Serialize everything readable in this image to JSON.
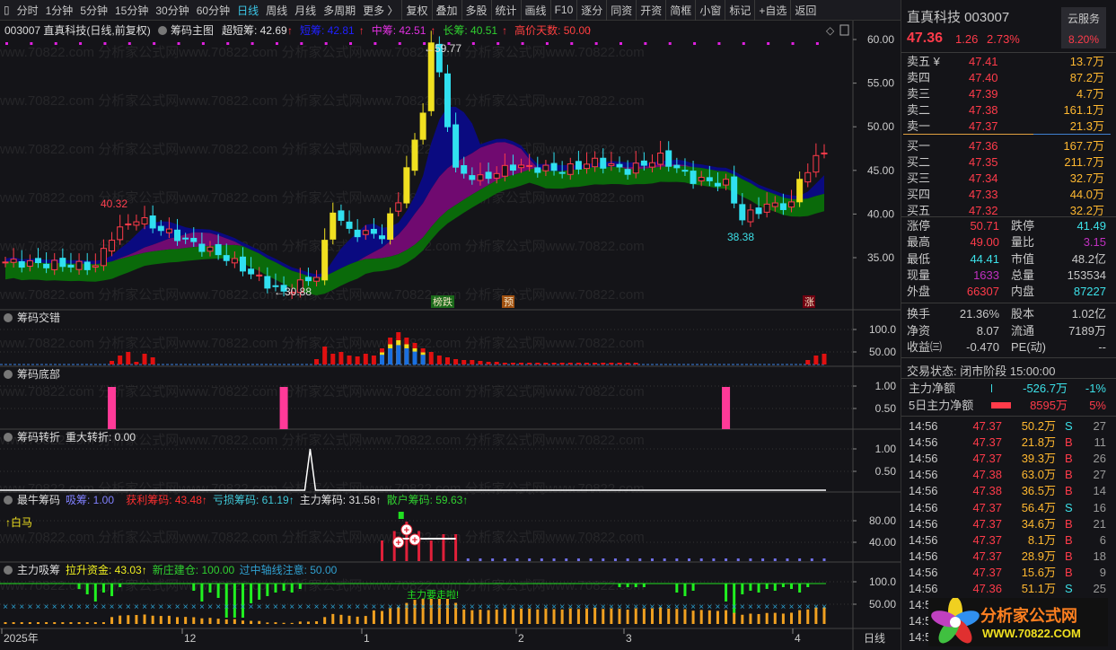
{
  "toolbar": {
    "items": [
      "分时",
      "1分钟",
      "5分钟",
      "15分钟",
      "30分钟",
      "60分钟",
      "日线",
      "周线",
      "月线",
      "多周期",
      "更多 〉",
      "复权",
      "叠加",
      "多股",
      "统计",
      "画线",
      "F10",
      "逐分",
      "同资",
      "开资",
      "简框",
      "小窗",
      "标记",
      "+自选",
      "返回"
    ],
    "active": "日线"
  },
  "main": {
    "title": "003007 直真科技(日线,前复权)",
    "indicator": "筹码主图",
    "labels": [
      {
        "t": "超短筹: 42.69",
        "c": "#e0e0e0"
      },
      {
        "t": "短筹: 42.81",
        "c": "#2020ff"
      },
      {
        "t": "中筹: 42.51",
        "c": "#e030e0"
      },
      {
        "t": "长筹: 40.51",
        "c": "#30d030"
      },
      {
        "t": "高价天数: 50.00",
        "c": "#ff4040"
      }
    ],
    "yticks": [
      "60.00",
      "55.00",
      "50.00",
      "45.00",
      "40.00",
      "35.00"
    ],
    "annotations": {
      "high": "59.77",
      "low": "30.88",
      "mark1": "40.32",
      "mark2": "38.38"
    },
    "tags": [
      "榜跌",
      "预",
      "涨"
    ],
    "price_anchors": [
      [
        0,
        34.5
      ],
      [
        11,
        34
      ],
      [
        13,
        37.5
      ],
      [
        16,
        39.5
      ],
      [
        22,
        37
      ],
      [
        27,
        35
      ],
      [
        32,
        32
      ],
      [
        34,
        31
      ],
      [
        38,
        33
      ],
      [
        39,
        36.5
      ],
      [
        40,
        40.5
      ],
      [
        42,
        38
      ],
      [
        46,
        37.6
      ],
      [
        48,
        41.5
      ],
      [
        49,
        45.5
      ],
      [
        50,
        48
      ],
      [
        51,
        52
      ],
      [
        52,
        59.5
      ],
      [
        53,
        56
      ],
      [
        55,
        45
      ],
      [
        58,
        44
      ],
      [
        62,
        45.5
      ],
      [
        68,
        45
      ],
      [
        72,
        46
      ],
      [
        76,
        45
      ],
      [
        80,
        46.5
      ],
      [
        84,
        44
      ],
      [
        88,
        43.5
      ],
      [
        90,
        39.5
      ],
      [
        93,
        41
      ],
      [
        96,
        41
      ],
      [
        97,
        44
      ],
      [
        100,
        47.3
      ]
    ]
  },
  "panels": [
    {
      "title": "筹码交错",
      "labels": [],
      "yticks": [
        "100.0",
        "50.00"
      ]
    },
    {
      "title": "筹码底部",
      "labels": [],
      "yticks": [
        "1.00",
        "0.50"
      ]
    },
    {
      "title": "筹码转折",
      "labels": [
        {
          "t": "重大转折: 0.00",
          "c": "#e0e0e0"
        }
      ],
      "yticks": [
        "1.00",
        "0.50"
      ]
    },
    {
      "title": "最牛筹码",
      "labels": [
        {
          "t": "吸筹: 1.00",
          "c": "#8080ff"
        },
        {
          "t": "获利筹码: 43.48↑",
          "c": "#ff3030"
        },
        {
          "t": "亏损筹码: 61.19↑",
          "c": "#40c8d8"
        },
        {
          "t": "主力筹码: 31.58↑",
          "c": "#e0e0e0"
        },
        {
          "t": "散户筹码: 59.63↑",
          "c": "#30d030"
        }
      ],
      "yticks": [
        "80.00",
        "40.00"
      ],
      "note": "↑白马"
    },
    {
      "title": "主力吸筹",
      "labels": [
        {
          "t": "拉升资金: 43.03↑",
          "c": "#f0f020"
        },
        {
          "t": "新庄建仓: 100.00",
          "c": "#30d030"
        },
        {
          "t": "过中轴线注意: 50.00",
          "c": "#30a0d0"
        }
      ],
      "yticks": [
        "100.0",
        "50.00"
      ],
      "note": "主力要走啦!"
    }
  ],
  "xaxis": {
    "labels": [
      "2025年",
      "12",
      "1",
      "2",
      "3",
      "4"
    ],
    "period": "日线"
  },
  "quote": {
    "name": "直真科技 003007",
    "price": "47.36",
    "change": "1.26",
    "pct": "2.73%",
    "cloud": "云服务",
    "cloud_pct": "8.20%"
  },
  "book": [
    [
      "卖五 ¥",
      "47.41",
      "13.7万"
    ],
    [
      "卖四",
      "47.40",
      "87.2万"
    ],
    [
      "卖三",
      "47.39",
      "4.7万"
    ],
    [
      "卖二",
      "47.38",
      "161.1万"
    ],
    [
      "卖一",
      "47.37",
      "21.3万"
    ],
    [
      "买一",
      "47.36",
      "167.7万"
    ],
    [
      "买二",
      "47.35",
      "211.7万"
    ],
    [
      "买三",
      "47.34",
      "32.7万"
    ],
    [
      "买四",
      "47.33",
      "44.0万"
    ],
    [
      "买五",
      "47.32",
      "32.2万"
    ]
  ],
  "stats": [
    [
      "涨停",
      "50.71",
      "r",
      "跌停",
      "41.49",
      "c"
    ],
    [
      "最高",
      "49.00",
      "r",
      "量比",
      "3.15",
      "p"
    ],
    [
      "最低",
      "44.41",
      "c",
      "市值",
      "48.2亿",
      "w"
    ],
    [
      "现量",
      "1633",
      "p",
      "总量",
      "153534",
      "w"
    ],
    [
      "外盘",
      "66307",
      "r",
      "内盘",
      "87227",
      "c"
    ]
  ],
  "stats2": [
    [
      "换手",
      "21.36%",
      "跌",
      "股本",
      "1.02亿"
    ],
    [
      "净资",
      "8.07",
      "",
      "流通",
      "7189万"
    ],
    [
      "收益㈢",
      "-0.470",
      "",
      "PE(动)",
      "--"
    ]
  ],
  "status": "交易状态: 闭市阶段 15:00:00",
  "flow": [
    [
      "主力净额",
      "-526.7万",
      "-1%"
    ],
    [
      "5日主力净额",
      "8595万",
      "5%"
    ]
  ],
  "trades": [
    [
      "14:56",
      "47.37",
      "50.2万",
      "S",
      "27"
    ],
    [
      "14:56",
      "47.37",
      "21.8万",
      "B",
      "11"
    ],
    [
      "14:56",
      "47.37",
      "39.3万",
      "B",
      "26"
    ],
    [
      "14:56",
      "47.38",
      "63.0万",
      "B",
      "27"
    ],
    [
      "14:56",
      "47.38",
      "36.5万",
      "B",
      "14"
    ],
    [
      "14:56",
      "47.37",
      "56.4万",
      "S",
      "16"
    ],
    [
      "14:56",
      "47.37",
      "34.6万",
      "B",
      "21"
    ],
    [
      "14:56",
      "47.37",
      "8.1万",
      "B",
      "6"
    ],
    [
      "14:56",
      "47.37",
      "28.9万",
      "B",
      "18"
    ],
    [
      "14:56",
      "47.37",
      "15.6万",
      "B",
      "9"
    ],
    [
      "14:56",
      "47.36",
      "51.1万",
      "S",
      "25"
    ],
    [
      "14:56",
      "",
      "",
      "",
      ""
    ],
    [
      "14:56",
      "",
      "",
      "",
      ""
    ],
    [
      "14:56",
      "",
      "",
      "",
      ""
    ]
  ],
  "logo": {
    "text": "分析家公式网",
    "url": "WWW.70822.COM"
  }
}
